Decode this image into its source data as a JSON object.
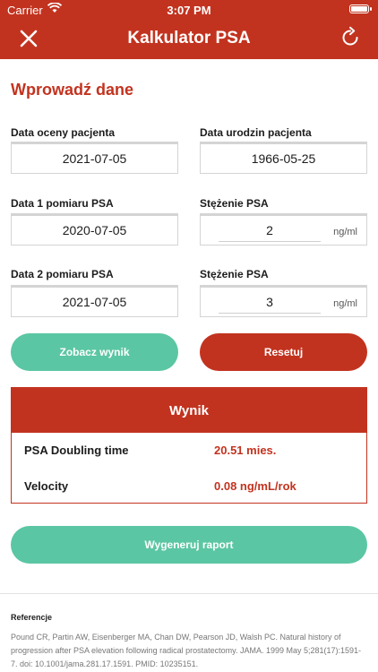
{
  "status_bar": {
    "carrier": "Carrier",
    "time": "3:07 PM"
  },
  "nav": {
    "title": "Kalkulator PSA",
    "close_icon": "close-icon",
    "refresh_icon": "refresh-icon"
  },
  "form": {
    "section_title": "Wprowadź dane",
    "assessment_date": {
      "label": "Data oceny pacjenta",
      "value": "2021-07-05"
    },
    "birth_date": {
      "label": "Data urodzin pacjenta",
      "value": "1966-05-25"
    },
    "psa1_date": {
      "label": "Data 1 pomiaru PSA",
      "value": "2020-07-05"
    },
    "psa1_conc": {
      "label": "Stężenie PSA",
      "value": "2",
      "unit": "ng/ml"
    },
    "psa2_date": {
      "label": "Data 2 pomiaru PSA",
      "value": "2021-07-05"
    },
    "psa2_conc": {
      "label": "Stężenie PSA",
      "value": "3",
      "unit": "ng/ml"
    }
  },
  "buttons": {
    "show_result": "Zobacz wynik",
    "reset": "Resetuj",
    "generate_report": "Wygeneruj raport"
  },
  "result": {
    "header": "Wynik",
    "doubling_label": "PSA Doubling time",
    "doubling_value": "20.51 mies.",
    "velocity_label": "Velocity",
    "velocity_value": "0.08 ng/mL/rok"
  },
  "references": {
    "title": "Referencje",
    "text": "Pound CR, Partin AW, Eisenberger MA, Chan DW, Pearson JD, Walsh PC. Natural history of progression after PSA elevation following radical prostatectomy. JAMA. 1999 May 5;281(17):1591-7. doi: 10.1001/jama.281.17.1591. PMID: 10235151."
  },
  "colors": {
    "primary": "#c2331f",
    "accent": "#5bc6a3"
  }
}
